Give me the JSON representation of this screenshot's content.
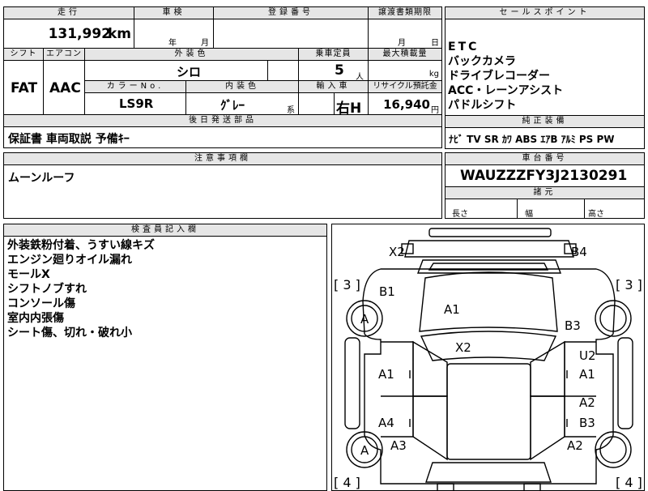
{
  "headers": {
    "mileage": "走行",
    "inspection": "車検",
    "registration": "登録番号",
    "transfer_deadline": "譲渡書類期限",
    "sales_points": "セールスポイント",
    "shift": "シフト",
    "ac": "エアコン",
    "exterior_color": "外装色",
    "capacity": "乗車定員",
    "max_load": "最大積載量",
    "color_no": "カラーNo.",
    "interior_color": "内装色",
    "import": "輸入車",
    "recycle": "リサイクル預託金",
    "later_parts": "後日発送部品",
    "genuine_equipment": "純正装備",
    "notes": "注意事項欄",
    "chassis_no": "車台番号",
    "dimensions": "諸元",
    "inspector": "検査員記入欄"
  },
  "vehicle": {
    "mileage": "131,992",
    "mileage_unit": "km",
    "inspection_year_unit": "年",
    "inspection_month_unit": "月",
    "transfer_month_unit": "月",
    "transfer_day_unit": "日",
    "shift": "FAT",
    "ac": "AAC",
    "exterior_color": "シロ",
    "capacity": "5",
    "capacity_unit": "人",
    "load_unit": "kg",
    "color_no": "LS9R",
    "interior_color": "ｸﾞﾚｰ",
    "interior_color_suffix": "系",
    "import": "右H",
    "recycle": "16,940",
    "recycle_unit": "円",
    "chassis_no": "WAUZZZFY3J2130291"
  },
  "sales_points": [
    "ETC",
    "バックカメラ",
    "ドライブレコーダー",
    "ACC・レーンアシスト",
    "パドルシフト"
  ],
  "later_parts": "保証書 車両取説 予備ｷｰ",
  "genuine_equipment": "ﾅﾋﾞ TV SR ｶﾜ ABS ｴｱB ｱﾙﾐ PS PW",
  "notes": "ムーンルーフ",
  "dimensions": {
    "length": "長さ",
    "width": "幅",
    "height": "高さ"
  },
  "inspector_notes": [
    "外装鉄粉付着、うすい線キズ",
    "エンジン廻りオイル漏れ",
    "モールX",
    "シフトノブすれ",
    "コンソール傷",
    "室内内張傷",
    "シート傷、切れ・破れ小"
  ],
  "diagram": {
    "tire_left_front": "[ 3 ]",
    "tire_right_front": "[ 3 ]",
    "tire_left_rear": "[ 4 ]",
    "tire_right_rear": "[ 4 ]",
    "marks": {
      "front_left_corner": "X2",
      "front_right_corner": "B4",
      "left_front_fender": "B1",
      "left_front_wheel": "A",
      "hood": "A1",
      "right_front_fender": "B3",
      "windshield": "X2",
      "right_front_door_upper": "U2",
      "left_front_door": "A1",
      "right_front_door": "A1",
      "right_rear_door_upper": "A2",
      "left_rear_door": "A4",
      "right_rear_door": "B3",
      "left_rear_wheel": "A",
      "left_rear_fender": "A3",
      "right_rear_fender": "A2"
    }
  }
}
